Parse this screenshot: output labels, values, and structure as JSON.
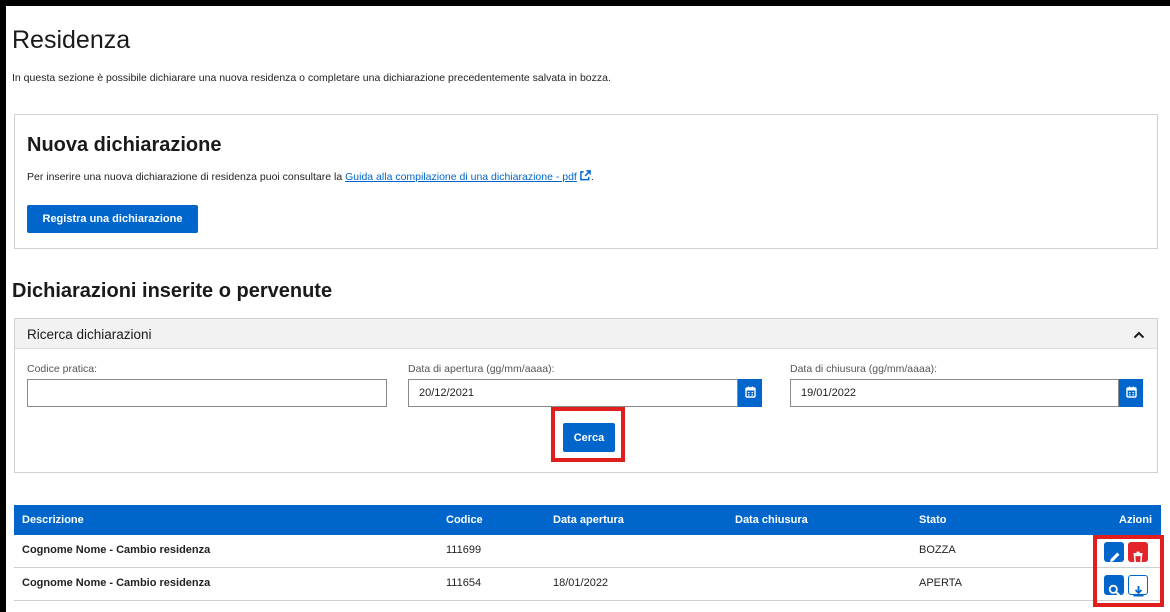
{
  "page": {
    "title": "Residenza",
    "description": "In questa sezione è possibile dichiarare una nuova residenza o completare una dichiarazione precedentemente salvata in bozza."
  },
  "nuova": {
    "title": "Nuova dichiarazione",
    "text": "Per inserire una nuova dichiarazione di residenza puoi consultare la",
    "link_text": "Guida alla compilazione di una dichiarazione - pdf",
    "button_label": "Registra una dichiarazione"
  },
  "dichiarazioni": {
    "title": "Dichiarazioni inserite o pervenute"
  },
  "ricerca": {
    "header": "Ricerca dichiarazioni",
    "codice_label": "Codice pratica:",
    "codice_value": "",
    "apertura_label": "Data di apertura (gg/mm/aaaa):",
    "apertura_value": "20/12/2021",
    "chiusura_label": "Data di chiusura (gg/mm/aaaa):",
    "chiusura_value": "19/01/2022",
    "search_button": "Cerca"
  },
  "table": {
    "headers": {
      "descrizione": "Descrizione",
      "codice": "Codice",
      "data_apertura": "Data apertura",
      "data_chiusura": "Data chiusura",
      "stato": "Stato",
      "azioni": "Azioni"
    },
    "rows": [
      {
        "descrizione": "Cognome Nome - Cambio residenza",
        "codice": "111699",
        "data_apertura": "",
        "data_chiusura": "",
        "stato": "BOZZA",
        "actions": [
          "edit-icon",
          "trash-icon"
        ]
      },
      {
        "descrizione": "Cognome Nome - Cambio residenza",
        "codice": "111654",
        "data_apertura": "18/01/2022",
        "data_chiusura": "",
        "stato": "APERTA",
        "actions": [
          "search-icon",
          "download-icon"
        ]
      }
    ]
  },
  "colors": {
    "primary": "#0066cc",
    "danger": "#e3242b",
    "highlight": "#e01e1e"
  }
}
